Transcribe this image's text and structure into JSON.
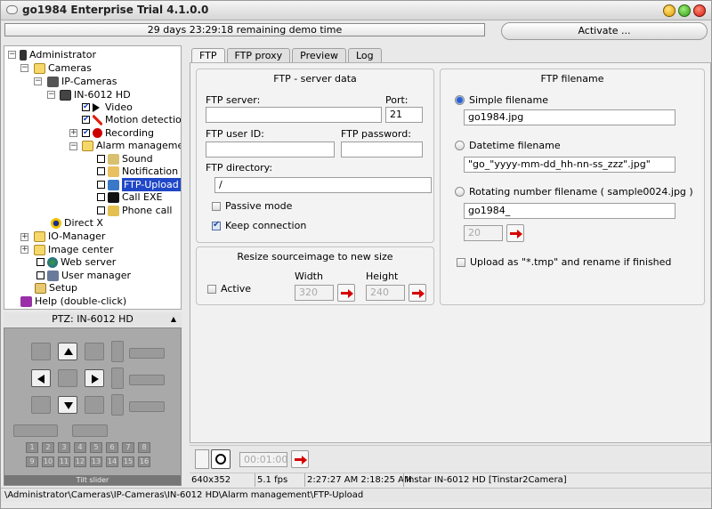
{
  "window": {
    "title": "go1984 Enterprise Trial 4.1.0.0"
  },
  "header": {
    "demo_text": "29 days 23:29:18 remaining demo time",
    "activate_label": "Activate ..."
  },
  "tree": {
    "administrator": "Administrator",
    "cameras": "Cameras",
    "ip_cameras": "IP-Cameras",
    "camera": "IN-6012 HD",
    "video": "Video",
    "motion": "Motion detection",
    "recording": "Recording",
    "alarm": "Alarm management",
    "sound": "Sound",
    "notification": "Notification",
    "ftp_upload": "FTP-Upload",
    "call_exe": "Call EXE",
    "phone_call": "Phone call",
    "directx": "Direct X",
    "io_manager": "IO-Manager",
    "image_center": "Image center",
    "web_server": "Web server",
    "user_manager": "User manager",
    "setup": "Setup",
    "help": "Help (double-click)"
  },
  "ptz": {
    "title": "PTZ: IN-6012 HD",
    "tilt_label": "Tilt slider",
    "numbers": [
      "1",
      "2",
      "3",
      "4",
      "5",
      "6",
      "7",
      "8",
      "9",
      "10",
      "11",
      "12",
      "13",
      "14",
      "15",
      "16"
    ]
  },
  "tabs": [
    {
      "label": "FTP"
    },
    {
      "label": "FTP proxy"
    },
    {
      "label": "Preview"
    },
    {
      "label": "Log"
    }
  ],
  "ftp_server": {
    "title": "FTP - server data",
    "server_label": "FTP server:",
    "server_value": "",
    "port_label": "Port:",
    "port_value": "21",
    "user_label": "FTP user ID:",
    "user_value": "",
    "password_label": "FTP password:",
    "password_value": "",
    "dir_label": "FTP directory:",
    "dir_value": "/",
    "passive_label": "Passive mode",
    "keep_label": "Keep connection"
  },
  "resize": {
    "title": "Resize sourceimage to new size",
    "active_label": "Active",
    "width_label": "Width",
    "width_value": "320",
    "height_label": "Height",
    "height_value": "240"
  },
  "ftp_filename": {
    "title": "FTP filename",
    "simple_label": "Simple filename",
    "simple_value": "go1984.jpg",
    "datetime_label": "Datetime filename",
    "datetime_value": "\"go_\"yyyy-mm-dd_hh-nn-ss_zzz\".jpg\"",
    "rotating_label": "Rotating number filename ( sample0024.jpg )",
    "rotating_value": "go1984_",
    "rotating_count": "20",
    "upload_tmp_label": "Upload as \"*.tmp\" and rename if finished"
  },
  "timer": {
    "value": "00:01:00"
  },
  "status": {
    "resolution": "640x352",
    "fps": "5.1 fps",
    "times": "2:27:27 AM 2:18:25 AM",
    "camera_info": "Instar IN-6012 HD [Tinstar2Camera]"
  },
  "path": "\\Administrator\\Cameras\\IP-Cameras\\IN-6012 HD\\Alarm management\\FTP-Upload"
}
